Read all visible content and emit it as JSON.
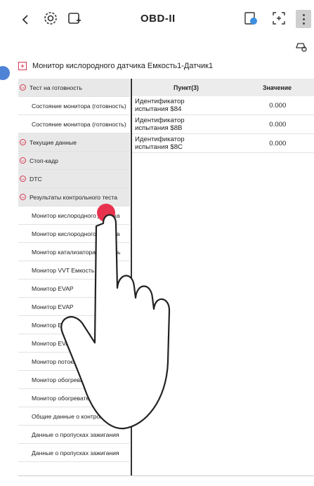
{
  "header": {
    "back_icon": "chevron-left-icon",
    "title": "OBD-II",
    "left_icons": [
      "engine-settings-icon",
      "vehicle-add-icon"
    ],
    "right_icons": [
      "report-icon",
      "screenshot-icon",
      "more-vertical-icon"
    ],
    "car_search_icon": "car-search-icon"
  },
  "section_title": "Монитор кислородного датчика Емкость1-Датчик1",
  "sidebar": {
    "items": [
      {
        "label": "Тест на готовность",
        "type": "category"
      },
      {
        "label": "Состояние монитора (готовность)",
        "type": "sub"
      },
      {
        "label": "Состояние монитора (готовность)",
        "type": "sub"
      },
      {
        "label": "Текущие данные",
        "type": "category"
      },
      {
        "label": "Стоп-кадр",
        "type": "category"
      },
      {
        "label": "DTC",
        "type": "category"
      },
      {
        "label": "Результаты контрольного теста",
        "type": "category"
      },
      {
        "label": "Монитор кислородного датчика",
        "type": "sub"
      },
      {
        "label": "Монитор кислородного датчика",
        "type": "sub"
      },
      {
        "label": "Монитор катализатора Емкость",
        "type": "sub"
      },
      {
        "label": "Монитор VVT Емкость",
        "type": "sub"
      },
      {
        "label": "Монитор EVAP",
        "type": "sub"
      },
      {
        "label": "Монитор EVAP",
        "type": "sub"
      },
      {
        "label": "Монитор EVAP -",
        "type": "sub"
      },
      {
        "label": "Монитор EVAP - (0.0",
        "type": "sub"
      },
      {
        "label": "Монитор потока продувки",
        "type": "sub"
      },
      {
        "label": "Монитор обогревателя кислородного",
        "type": "sub"
      },
      {
        "label": "Монитор обогревателя кислородного",
        "type": "sub"
      },
      {
        "label": "Общие данные о контроле пропусков",
        "type": "sub"
      },
      {
        "label": "Данные о пропусках зажигания",
        "type": "sub"
      },
      {
        "label": "Данные о пропусках зажигания",
        "type": "sub"
      }
    ]
  },
  "table": {
    "columns": [
      "Пункт(3)",
      "Значение"
    ],
    "rows": [
      {
        "item_line1": "Идентификатор",
        "item_line2": "испытания $84",
        "value": "0.000"
      },
      {
        "item_line1": "Идентификатор",
        "item_line2": "испытания $8B",
        "value": "0.000"
      },
      {
        "item_line1": "Идентификатор",
        "item_line2": "испытания $8C",
        "value": "0.000"
      }
    ]
  },
  "colors": {
    "accent_red": "#d9364f",
    "touch_point": "#e8324d",
    "blue_marker": "#4f83d6"
  }
}
